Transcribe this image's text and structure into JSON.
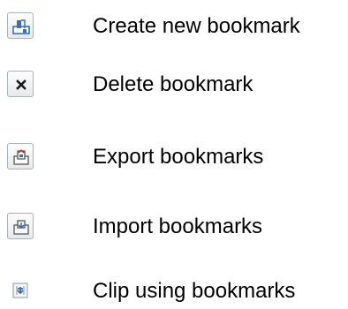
{
  "legend": {
    "items": [
      {
        "icon": "create-bookmark-icon",
        "label": "Create new bookmark"
      },
      {
        "icon": "delete-bookmark-icon",
        "label": "Delete bookmark"
      },
      {
        "icon": "export-bookmarks-icon",
        "label": "Export bookmarks"
      },
      {
        "icon": "import-bookmarks-icon",
        "label": "Import bookmarks"
      },
      {
        "icon": "clip-bookmarks-icon",
        "label": "Clip using bookmarks"
      }
    ]
  },
  "colors": {
    "icon_blue": "#2f6fc4",
    "icon_border": "#a9b3bd",
    "text": "#000000"
  }
}
